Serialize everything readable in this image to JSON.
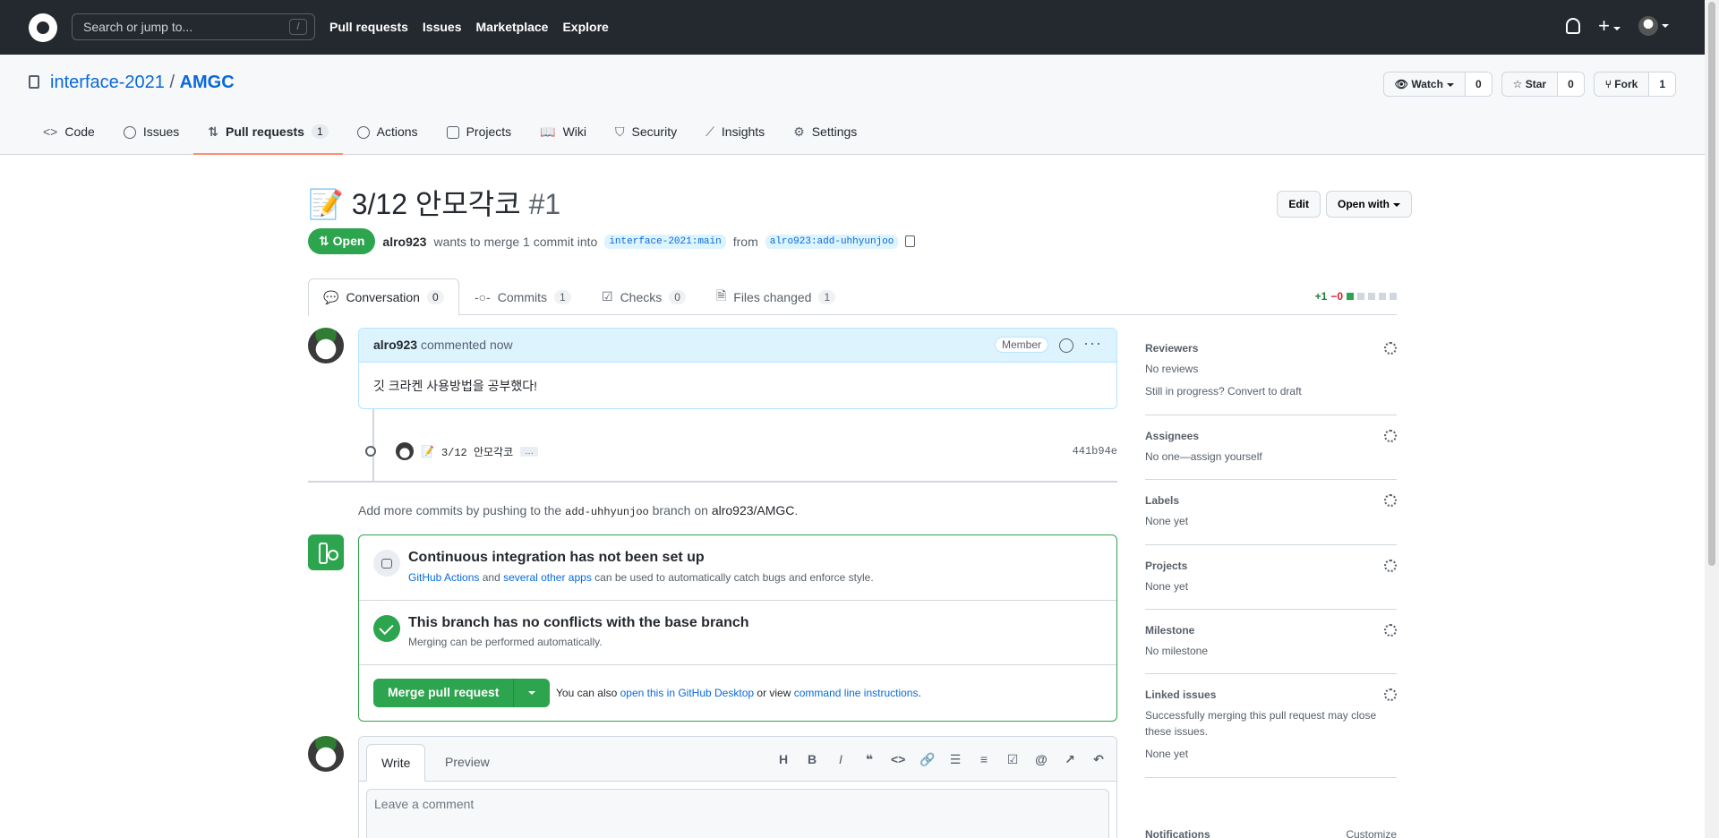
{
  "header": {
    "search_placeholder": "Search or jump to...",
    "search_shortcut": "/",
    "nav": [
      "Pull requests",
      "Issues",
      "Marketplace",
      "Explore"
    ],
    "plus_icon": "+"
  },
  "repo": {
    "owner": "interface-2021",
    "separator": "/",
    "name": "AMGC",
    "watch_label": "Watch",
    "watch_count": "0",
    "star_label": "Star",
    "star_count": "0",
    "fork_label": "Fork",
    "fork_count": "1",
    "tabs": [
      {
        "label": "Code",
        "icon": "code-icon"
      },
      {
        "label": "Issues",
        "icon": "issue-icon"
      },
      {
        "label": "Pull requests",
        "icon": "pull-request-icon",
        "count": "1"
      },
      {
        "label": "Actions",
        "icon": "play-icon"
      },
      {
        "label": "Projects",
        "icon": "project-icon"
      },
      {
        "label": "Wiki",
        "icon": "book-icon"
      },
      {
        "label": "Security",
        "icon": "shield-icon"
      },
      {
        "label": "Insights",
        "icon": "graph-icon"
      },
      {
        "label": "Settings",
        "icon": "gear-icon"
      }
    ]
  },
  "pr": {
    "emoji": "📝",
    "title": "3/12 안모각코",
    "number": "#1",
    "edit_label": "Edit",
    "open_with_label": "Open with",
    "state": "Open",
    "author": "alro923",
    "merge_text": "wants to merge 1 commit into",
    "base_branch": "interface-2021:main",
    "from_text": "from",
    "head_branch": "alro923:add-uhhyunjoo",
    "tabs": [
      {
        "label": "Conversation",
        "count": "0"
      },
      {
        "label": "Commits",
        "count": "1"
      },
      {
        "label": "Checks",
        "count": "0"
      },
      {
        "label": "Files changed",
        "count": "1"
      }
    ],
    "diff_add": "+1",
    "diff_del": "−0"
  },
  "comment": {
    "author": "alro923",
    "action": "commented now",
    "role": "Member",
    "more": "···",
    "body": "깃 크라켄 사용방법을 공부했다!"
  },
  "commit": {
    "emoji": "📝",
    "message": "3/12 안모각코",
    "ellipsis": "…",
    "sha": "441b94e"
  },
  "push_hint": {
    "prefix": "Add more commits by pushing to the",
    "branch": "add-uhhyunjoo",
    "middle": "branch on",
    "repo": "alro923/AMGC",
    "suffix": "."
  },
  "merge": {
    "ci_title": "Continuous integration has not been set up",
    "ci_link1": "GitHub Actions",
    "ci_and": "and",
    "ci_link2": "several other apps",
    "ci_rest": "can be used to automatically catch bugs and enforce style.",
    "conflict_title": "This branch has no conflicts with the base branch",
    "conflict_sub": "Merging can be performed automatically.",
    "merge_button": "Merge pull request",
    "also_prefix": "You can also",
    "also_link1": "open this in GitHub Desktop",
    "also_or": "or view",
    "also_link2": "command line instructions",
    "also_suffix": "."
  },
  "composer": {
    "write_tab": "Write",
    "preview_tab": "Preview",
    "toolbar": [
      "H",
      "B",
      "I"
    ],
    "placeholder": "Leave a comment"
  },
  "sidebar": {
    "sections": [
      {
        "label": "Reviewers",
        "value": "No reviews",
        "extra": "Still in progress? Convert to draft"
      },
      {
        "label": "Assignees",
        "value": "No one—assign yourself"
      },
      {
        "label": "Labels",
        "value": "None yet"
      },
      {
        "label": "Projects",
        "value": "None yet"
      },
      {
        "label": "Milestone",
        "value": "No milestone"
      },
      {
        "label": "Linked issues",
        "value": "Successfully merging this pull request may close these issues.",
        "extra": "None yet"
      }
    ],
    "notifications": "Notifications",
    "customize": "Customize"
  },
  "colors": {
    "header_bg": "#24292f",
    "open_green": "#2da44e",
    "link_blue": "#0969da",
    "tab_underline": "#fd8c73"
  }
}
